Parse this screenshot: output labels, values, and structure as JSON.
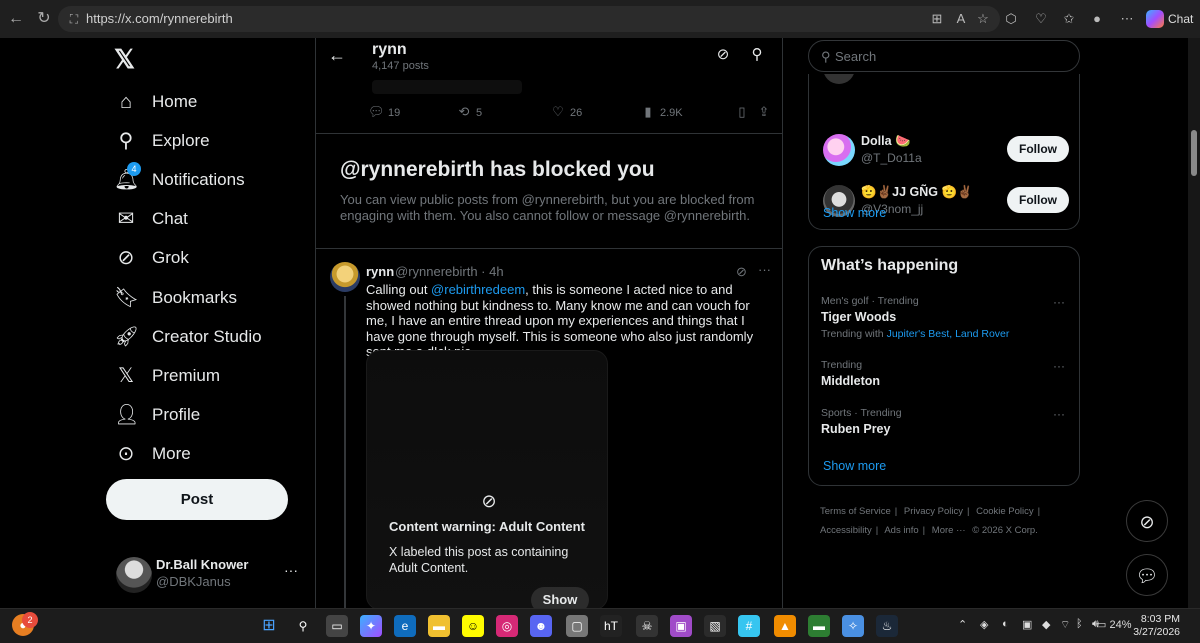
{
  "browser": {
    "url": "https://x.com/rynnerebirth",
    "copilot_label": "Chat"
  },
  "leftnav": {
    "items": [
      {
        "label": "Home",
        "icon": "home-icon"
      },
      {
        "label": "Explore",
        "icon": "search-icon"
      },
      {
        "label": "Notifications",
        "icon": "bell-icon",
        "badge": "4"
      },
      {
        "label": "Chat",
        "icon": "envelope-icon"
      },
      {
        "label": "Grok",
        "icon": "grok-icon"
      },
      {
        "label": "Bookmarks",
        "icon": "bookmark-icon"
      },
      {
        "label": "Creator Studio",
        "icon": "rocket-icon"
      },
      {
        "label": "Premium",
        "icon": "x-icon"
      },
      {
        "label": "Profile",
        "icon": "person-icon"
      },
      {
        "label": "More",
        "icon": "more-circle-icon"
      }
    ],
    "post_label": "Post",
    "account": {
      "name": "Dr.Ball Knower",
      "handle": "@DBKJanus"
    }
  },
  "header": {
    "title": "rynn",
    "post_count": "4,147 posts"
  },
  "top_actions": {
    "replies": "19",
    "reposts": "5",
    "likes": "26",
    "views": "2.9K"
  },
  "blocked": {
    "title": "@rynnerebirth has blocked you",
    "description": "You can view public posts from @rynnerebirth, but you are blocked from engaging with them. You also cannot follow or message @rynnerebirth."
  },
  "tweet": {
    "name": "rynn",
    "handle": "@rynnerebirth · 4h",
    "body_before": "Calling out ",
    "mention": "@rebirthredeem",
    "body_after": ", this is someone I acted nice to and showed nothing but kindness to. Many know me and can vouch for me, I have an entire thread upon my experiences and things that I have gone through myself. This is someone who also just randomly sent me a d!ck pic",
    "content_warning": "Content warning: Adult Content",
    "content_warning_desc": "X labeled this post as containing Adult Content.",
    "show_label": "Show"
  },
  "right": {
    "search_placeholder": "Search",
    "follow": [
      {
        "name": "Dolla 🍉",
        "handle": "@T_Do11a",
        "button": "Follow"
      },
      {
        "name": "🫡✌🏾JJ GÑG 🫡✌🏾",
        "handle": "@V3nom_jj",
        "button": "Follow"
      }
    ],
    "follow_show_more": "Show more",
    "happening_title": "What’s happening",
    "trends": [
      {
        "meta": "Men's golf · Trending",
        "topic": "Tiger Woods",
        "with_label": "Trending with ",
        "with_links": "Jupiter's Best, Land Rover"
      },
      {
        "meta": "Trending",
        "topic": "Middleton"
      },
      {
        "meta": "Sports · Trending",
        "topic": "Ruben Prey"
      }
    ],
    "happening_show_more": "Show more",
    "footer": {
      "terms": "Terms of Service",
      "privacy": "Privacy Policy",
      "cookie": "Cookie Policy",
      "accessibility": "Accessibility",
      "ads": "Ads info",
      "more": "More ···",
      "copyright": "© 2026 X Corp."
    }
  },
  "taskbar": {
    "notif_count": "2",
    "battery": "24%",
    "time": "8:03 PM",
    "date": "3/27/2026"
  },
  "colors": {
    "accent": "#1d9bf0",
    "background": "#000000",
    "border": "#2f3336",
    "muted": "#71767b"
  }
}
